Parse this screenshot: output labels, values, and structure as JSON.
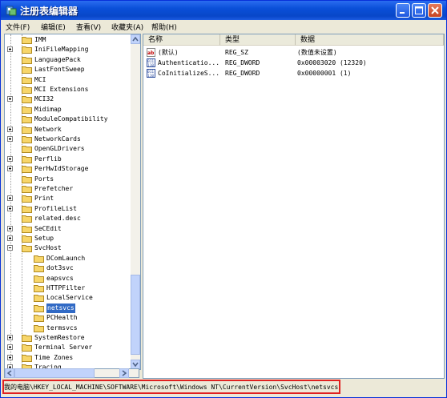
{
  "window": {
    "title": "注册表编辑器"
  },
  "menu": [
    "文件(F)",
    "编辑(E)",
    "查看(V)",
    "收藏夹(A)",
    "帮助(H)"
  ],
  "tree": {
    "items": [
      {
        "label": "IMM",
        "expander": "none",
        "level": 1
      },
      {
        "label": "IniFileMapping",
        "expander": "plus",
        "level": 1
      },
      {
        "label": "LanguagePack",
        "expander": "none",
        "level": 1
      },
      {
        "label": "LastFontSweep",
        "expander": "none",
        "level": 1
      },
      {
        "label": "MCI",
        "expander": "none",
        "level": 1
      },
      {
        "label": "MCI Extensions",
        "expander": "none",
        "level": 1
      },
      {
        "label": "MCI32",
        "expander": "plus",
        "level": 1
      },
      {
        "label": "Midimap",
        "expander": "none",
        "level": 1
      },
      {
        "label": "ModuleCompatibility",
        "expander": "none",
        "level": 1
      },
      {
        "label": "Network",
        "expander": "plus",
        "level": 1
      },
      {
        "label": "NetworkCards",
        "expander": "plus",
        "level": 1
      },
      {
        "label": "OpenGLDrivers",
        "expander": "none",
        "level": 1
      },
      {
        "label": "Perflib",
        "expander": "plus",
        "level": 1
      },
      {
        "label": "PerHwIdStorage",
        "expander": "plus",
        "level": 1
      },
      {
        "label": "Ports",
        "expander": "none",
        "level": 1
      },
      {
        "label": "Prefetcher",
        "expander": "none",
        "level": 1
      },
      {
        "label": "Print",
        "expander": "plus",
        "level": 1
      },
      {
        "label": "ProfileList",
        "expander": "plus",
        "level": 1
      },
      {
        "label": "related.desc",
        "expander": "none",
        "level": 1
      },
      {
        "label": "SeCEdit",
        "expander": "plus",
        "level": 1
      },
      {
        "label": "Setup",
        "expander": "plus",
        "level": 1
      },
      {
        "label": "SvcHost",
        "expander": "minus",
        "level": 1
      },
      {
        "label": "DComLaunch",
        "expander": "none",
        "level": 2
      },
      {
        "label": "dot3svc",
        "expander": "none",
        "level": 2
      },
      {
        "label": "eapsvcs",
        "expander": "none",
        "level": 2
      },
      {
        "label": "HTTPFilter",
        "expander": "none",
        "level": 2
      },
      {
        "label": "LocalService",
        "expander": "none",
        "level": 2
      },
      {
        "label": "netsvcs",
        "expander": "none",
        "level": 2,
        "selected": true
      },
      {
        "label": "PCHealth",
        "expander": "none",
        "level": 2
      },
      {
        "label": "termsvcs",
        "expander": "none",
        "level": 2
      },
      {
        "label": "SystemRestore",
        "expander": "plus",
        "level": 1
      },
      {
        "label": "Terminal Server",
        "expander": "plus",
        "level": 1
      },
      {
        "label": "Time Zones",
        "expander": "plus",
        "level": 1
      },
      {
        "label": "Tracing",
        "expander": "plus",
        "level": 1
      }
    ]
  },
  "list": {
    "columns": [
      "名称",
      "类型",
      "数据"
    ],
    "rows": [
      {
        "icon": "string-value-icon",
        "name": "(默认)",
        "type": "REG_SZ",
        "data": "(数值未设置)"
      },
      {
        "icon": "binary-value-icon",
        "name": "Authenticatio...",
        "type": "REG_DWORD",
        "data": "0x00003020 (12320)"
      },
      {
        "icon": "binary-value-icon",
        "name": "CoInitializeS...",
        "type": "REG_DWORD",
        "data": "0x00000001 (1)"
      }
    ]
  },
  "status": {
    "path": "我的电脑\\HKEY_LOCAL_MACHINE\\SOFTWARE\\Microsoft\\Windows NT\\CurrentVersion\\SvcHost\\netsvcs"
  },
  "colors": {
    "titlebar": "#0a4fd8",
    "selection": "#316ac5",
    "highlight_border": "#e02020"
  }
}
